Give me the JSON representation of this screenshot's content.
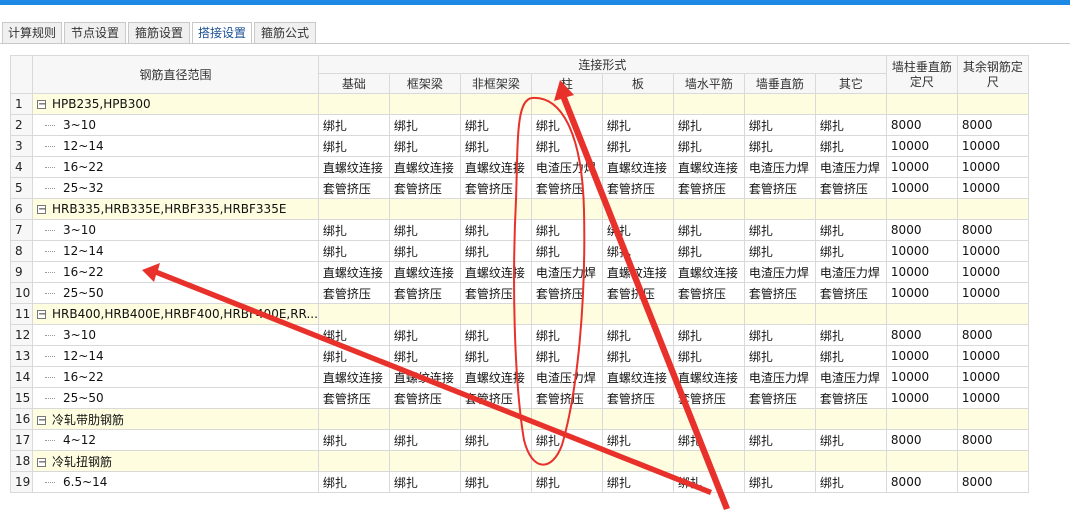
{
  "tabs": [
    {
      "label": "计算规则",
      "active": false
    },
    {
      "label": "节点设置",
      "active": false
    },
    {
      "label": "箍筋设置",
      "active": false
    },
    {
      "label": "搭接设置",
      "active": true
    },
    {
      "label": "箍筋公式",
      "active": false
    }
  ],
  "table": {
    "diameter_header": "钢筋直径范围",
    "connection_group_header": "连接形式",
    "connection_columns": [
      "基础",
      "框架梁",
      "非框架梁",
      "柱",
      "板",
      "墙水平筋",
      "墙垂直筋",
      "其它"
    ],
    "wall_col_header": "墙柱垂直筋定尺",
    "other_col_header": "其余钢筋定尺",
    "rows": [
      {
        "n": "1",
        "group": true,
        "label": "HPB235,HPB300"
      },
      {
        "n": "2",
        "label": "3~10",
        "cells": [
          "绑扎",
          "绑扎",
          "绑扎",
          "绑扎",
          "绑扎",
          "绑扎",
          "绑扎",
          "绑扎",
          "8000",
          "8000"
        ]
      },
      {
        "n": "3",
        "label": "12~14",
        "cells": [
          "绑扎",
          "绑扎",
          "绑扎",
          "绑扎",
          "绑扎",
          "绑扎",
          "绑扎",
          "绑扎",
          "10000",
          "10000"
        ]
      },
      {
        "n": "4",
        "label": "16~22",
        "cells": [
          "直螺纹连接",
          "直螺纹连接",
          "直螺纹连接",
          "电渣压力焊",
          "直螺纹连接",
          "直螺纹连接",
          "电渣压力焊",
          "电渣压力焊",
          "10000",
          "10000"
        ]
      },
      {
        "n": "5",
        "label": "25~32",
        "cells": [
          "套管挤压",
          "套管挤压",
          "套管挤压",
          "套管挤压",
          "套管挤压",
          "套管挤压",
          "套管挤压",
          "套管挤压",
          "10000",
          "10000"
        ]
      },
      {
        "n": "6",
        "group": true,
        "label": "HRB335,HRB335E,HRBF335,HRBF335E"
      },
      {
        "n": "7",
        "label": "3~10",
        "cells": [
          "绑扎",
          "绑扎",
          "绑扎",
          "绑扎",
          "绑扎",
          "绑扎",
          "绑扎",
          "绑扎",
          "8000",
          "8000"
        ]
      },
      {
        "n": "8",
        "label": "12~14",
        "cells": [
          "绑扎",
          "绑扎",
          "绑扎",
          "绑扎",
          "绑扎",
          "绑扎",
          "绑扎",
          "绑扎",
          "10000",
          "10000"
        ]
      },
      {
        "n": "9",
        "label": "16~22",
        "cells": [
          "直螺纹连接",
          "直螺纹连接",
          "直螺纹连接",
          "电渣压力焊",
          "直螺纹连接",
          "直螺纹连接",
          "电渣压力焊",
          "电渣压力焊",
          "10000",
          "10000"
        ]
      },
      {
        "n": "10",
        "label": "25~50",
        "cells": [
          "套管挤压",
          "套管挤压",
          "套管挤压",
          "套管挤压",
          "套管挤压",
          "套管挤压",
          "套管挤压",
          "套管挤压",
          "10000",
          "10000"
        ]
      },
      {
        "n": "11",
        "group": true,
        "label": "HRB400,HRB400E,HRBF400,HRBF400E,RR..."
      },
      {
        "n": "12",
        "label": "3~10",
        "cells": [
          "绑扎",
          "绑扎",
          "绑扎",
          "绑扎",
          "绑扎",
          "绑扎",
          "绑扎",
          "绑扎",
          "8000",
          "8000"
        ]
      },
      {
        "n": "13",
        "label": "12~14",
        "cells": [
          "绑扎",
          "绑扎",
          "绑扎",
          "绑扎",
          "绑扎",
          "绑扎",
          "绑扎",
          "绑扎",
          "10000",
          "10000"
        ]
      },
      {
        "n": "14",
        "label": "16~22",
        "cells": [
          "直螺纹连接",
          "直螺纹连接",
          "直螺纹连接",
          "电渣压力焊",
          "直螺纹连接",
          "直螺纹连接",
          "电渣压力焊",
          "电渣压力焊",
          "10000",
          "10000"
        ]
      },
      {
        "n": "15",
        "label": "25~50",
        "cells": [
          "套管挤压",
          "套管挤压",
          "套管挤压",
          "套管挤压",
          "套管挤压",
          "套管挤压",
          "套管挤压",
          "套管挤压",
          "10000",
          "10000"
        ]
      },
      {
        "n": "16",
        "group": true,
        "label": "冷轧带肋钢筋"
      },
      {
        "n": "17",
        "label": "4~12",
        "cells": [
          "绑扎",
          "绑扎",
          "绑扎",
          "绑扎",
          "绑扎",
          "绑扎",
          "绑扎",
          "绑扎",
          "8000",
          "8000"
        ]
      },
      {
        "n": "18",
        "group": true,
        "label": "冷轧扭钢筋"
      },
      {
        "n": "19",
        "label": "6.5~14",
        "cells": [
          "绑扎",
          "绑扎",
          "绑扎",
          "绑扎",
          "绑扎",
          "绑扎",
          "绑扎",
          "绑扎",
          "8000",
          "8000"
        ]
      }
    ]
  },
  "colors": {
    "accent": "#1e88e5",
    "annotation": "#e8312a",
    "group_row": "#fffde0"
  },
  "icons": {
    "expander": "collapse-minus-icon"
  }
}
